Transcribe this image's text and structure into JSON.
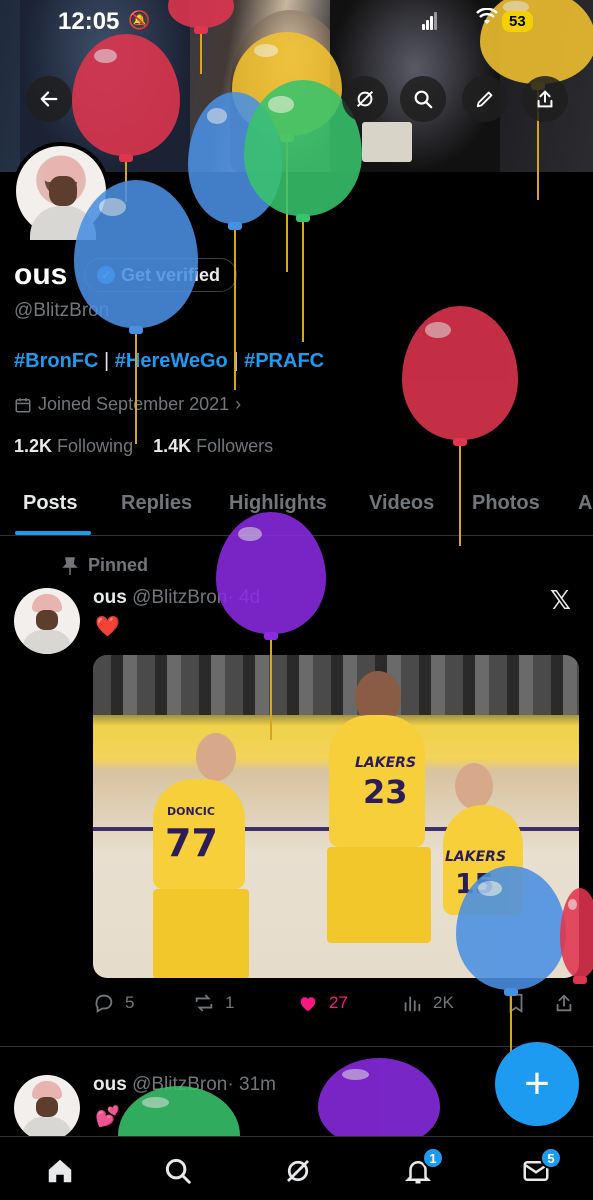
{
  "status_bar": {
    "time": "12:05",
    "battery": "53"
  },
  "profile": {
    "name": "ous",
    "verify_label": "Get verified",
    "handle": "@BlitzBron",
    "bio_tags": [
      "#BronFC",
      "#HereWeGo",
      "#PRAFC"
    ],
    "bio_sep": " | ",
    "joined": "Joined September 2021",
    "following_count": "1.2K",
    "following_label": "Following",
    "followers_count": "1.4K",
    "followers_label": "Followers"
  },
  "tabs": [
    "Posts",
    "Replies",
    "Highlights",
    "Videos",
    "Photos",
    "A"
  ],
  "pinned_label": "Pinned",
  "tweets": [
    {
      "name": "ous",
      "handle": "@BlitzBron",
      "time": "· 4d",
      "text": "❤️",
      "replies": "5",
      "reposts": "1",
      "likes": "27",
      "views": "2K",
      "jersey_numbers": [
        "77",
        "23",
        "15"
      ],
      "jersey_text": [
        "DONCIC",
        "LAKERS",
        "LAKERS"
      ]
    },
    {
      "name": "ous",
      "handle": "@BlitzBron",
      "time": "· 31m",
      "text": "💕"
    }
  ],
  "fab_label": "+",
  "nav_badges": {
    "notifications": "1",
    "messages": "5"
  },
  "colors": {
    "accent": "#1d9bf0",
    "like": "#f91880",
    "background": "#000000"
  },
  "balloon_colors": [
    "#e0354f",
    "#4a90e2",
    "#f2c230",
    "#38c46c",
    "#8a2be2"
  ]
}
